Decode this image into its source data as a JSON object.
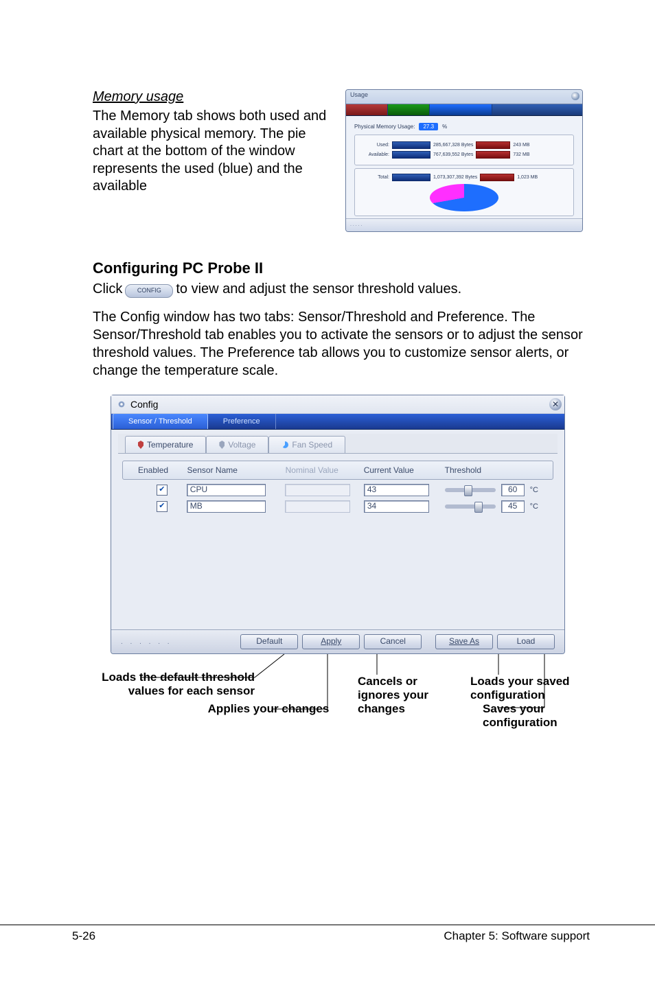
{
  "section1": {
    "heading": "Memory usage",
    "para": "The Memory tab shows both used and available physical memory. The pie chart at the bottom of the window represents the used (blue) and the available"
  },
  "memWindow": {
    "title": "Usage",
    "pcnt_label": "Physical Memory Usage:",
    "pcnt_value": "27.3",
    "pcnt_suffix": "%",
    "rows": [
      {
        "label": "Used:",
        "bytes": "285,667,328 Bytes",
        "mb": "243 MB"
      },
      {
        "label": "Available:",
        "bytes": "767,639,552 Bytes",
        "mb": "732 MB"
      }
    ],
    "totalRow": {
      "label": "Total:",
      "bytes": "1,073,307,392 Bytes",
      "mb": "1,023 MB"
    },
    "dots": ". . . . ."
  },
  "h2": "Configuring PC Probe II",
  "clickLine": {
    "before": "Click",
    "btn": "CONFIG",
    "after": "to view and adjust the sensor threshold values."
  },
  "para2": "The Config window has two tabs: Sensor/Threshold and Preference. The Sensor/Threshold tab enables you to activate the sensors or to adjust the sensor threshold values. The Preference tab allows you to customize sensor alerts, or change the temperature scale.",
  "config": {
    "title": "Config",
    "tabs": {
      "sensor": "Sensor / Threshold",
      "pref": "Preference"
    },
    "subtabs": {
      "temp": "Temperature",
      "volt": "Voltage",
      "fan": "Fan Speed"
    },
    "headers": {
      "enabled": "Enabled",
      "sensorName": "Sensor Name",
      "nominal": "Nominal Value",
      "current": "Current Value",
      "threshold": "Threshold"
    },
    "rows": [
      {
        "name": "CPU",
        "current": "43",
        "threshold": "60",
        "unit": "°C",
        "thumb": 0.38
      },
      {
        "name": "MB",
        "current": "34",
        "threshold": "45",
        "unit": "°C",
        "thumb": 0.58
      }
    ],
    "footerDots": ". . . . . .",
    "buttons": {
      "default": "Default",
      "apply": "Apply",
      "cancel": "Cancel",
      "saveas": "Save As",
      "load": "Load"
    }
  },
  "annotations": {
    "loadsDefault": "Loads the default threshold values for each sensor",
    "applies": "Applies your changes",
    "cancels": "Cancels or ignores your changes",
    "loadsSaved": "Loads your saved configuration",
    "saves": "Saves your configuration"
  },
  "footer": {
    "left": "5-26",
    "right": "Chapter 5: Software support"
  }
}
